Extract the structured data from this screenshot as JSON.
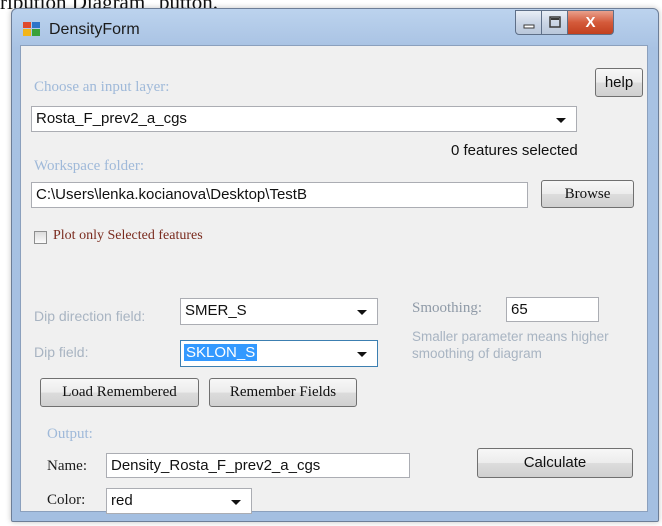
{
  "clipped_text": "ribution Diagram\" button.",
  "window": {
    "title": "DensityForm",
    "close_glyph": "X"
  },
  "help_label": "help",
  "input_layer": {
    "label": "Choose an input layer:",
    "value": "Rosta_F_prev2_a_cgs",
    "features_selected": "0 features selected"
  },
  "workspace": {
    "label": "Workspace folder:",
    "value": "C:\\Users\\lenka.kocianova\\Desktop\\TestB",
    "browse_label": "Browse"
  },
  "plot_selected": {
    "label": "Plot only Selected features",
    "checked": false
  },
  "fields": {
    "dip_direction_label": "Dip direction field:",
    "dip_direction_value": "SMER_S",
    "dip_label": "Dip field:",
    "dip_value": "SKLON_S"
  },
  "smoothing": {
    "label": "Smoothing:",
    "value": "65",
    "hint_line1": "Smaller parameter means higher",
    "hint_line2": "smoothing of diagram"
  },
  "buttons": {
    "load_remembered": "Load Remembered",
    "remember_fields": "Remember Fields",
    "calculate": "Calculate"
  },
  "output": {
    "heading": "Output:",
    "name_label": "Name:",
    "name_value": "Density_Rosta_F_prev2_a_cgs",
    "color_label": "Color:",
    "color_value": "red"
  },
  "icons": {
    "app": "app-window-icon",
    "minimize": "minimize-icon",
    "maximize": "maximize-icon",
    "close": "close-icon"
  },
  "colors": {
    "selection": "#3399ff",
    "label_blue": "#9fb9d9",
    "close_red": "#c2401f"
  }
}
